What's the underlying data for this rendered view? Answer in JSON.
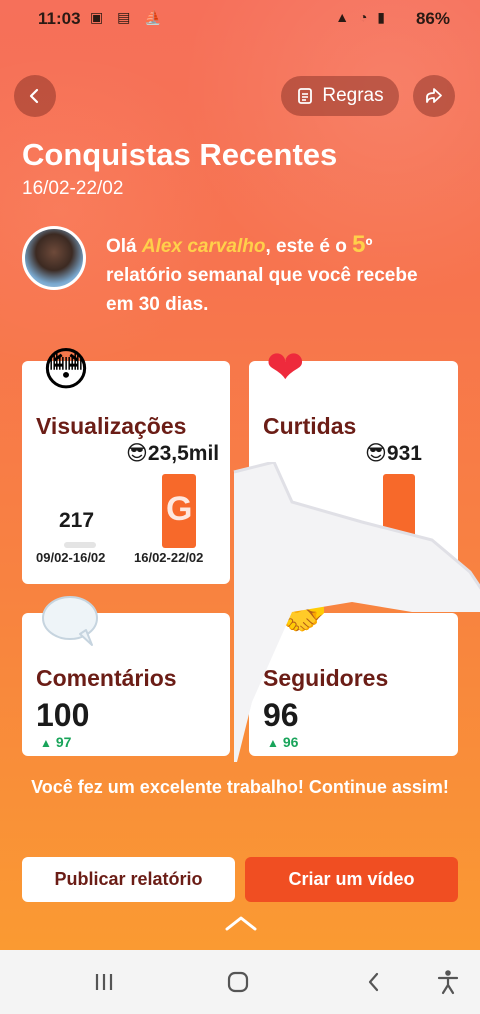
{
  "status_bar": {
    "time": "11:03",
    "battery": "86%"
  },
  "header": {
    "rules_label": "Regras",
    "title": "Conquistas Recentes",
    "date_range": "16/02-22/02"
  },
  "intro": {
    "greeting": "Olá ",
    "user_name": "Alex carvalho",
    "text_middle": ", este é o ",
    "ordinal_number": "5",
    "ordinal_suffix": "º",
    "text_end": " relatório semanal que você recebe em 30 dias."
  },
  "cards": {
    "views": {
      "title": "Visualizações",
      "current_emoji": "😎",
      "current_value": "23,5mil",
      "previous_value": "217",
      "previous_label": "09/02-16/02",
      "current_label": "16/02-22/02"
    },
    "likes": {
      "title": "Curtidas",
      "current_emoji": "😎",
      "current_value": "931"
    },
    "comments": {
      "title": "Comentários",
      "value": "100",
      "delta": "97"
    },
    "followers": {
      "title": "Seguidores",
      "value": "96",
      "delta": "96"
    }
  },
  "watermark": "GB",
  "congrats": "Você fez um excelente trabalho! Continue assim!",
  "actions": {
    "publish_label": "Publicar relatório",
    "create_label": "Criar um vídeo"
  },
  "colors": {
    "accent": "#f04e22",
    "title_dark": "#6b1d16",
    "name_yellow": "#ffd04a",
    "delta_green": "#19a45a"
  }
}
